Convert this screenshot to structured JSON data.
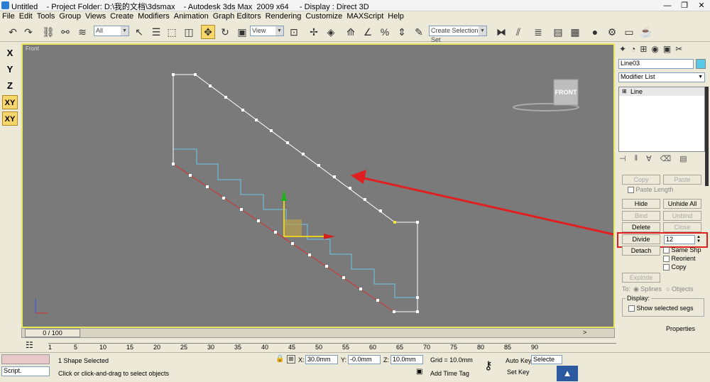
{
  "window": {
    "title": "Untitled    - Project Folder: D:\\我的文档\\3dsmax    - Autodesk 3ds Max  2009 x64     - Display : Direct 3D"
  },
  "menu": [
    "File",
    "Edit",
    "Tools",
    "Group",
    "Views",
    "Create",
    "Modifiers",
    "Animation",
    "Graph Editors",
    "Rendering",
    "Customize",
    "MAXScript",
    "Help"
  ],
  "toolbar": {
    "selection_filter": "All",
    "ref_coord": "View",
    "named_selection_placeholder": "Create Selection Set"
  },
  "axis_constraints": [
    "X",
    "Y",
    "Z",
    "XY",
    "XY"
  ],
  "viewport": {
    "label": "Front",
    "viewcube_label": "FRONT"
  },
  "command_panel": {
    "object_name": "Line03",
    "modifier_list": "Modifier List",
    "stack_item": "Line",
    "buttons": {
      "copy": "Copy",
      "paste": "Paste",
      "paste_length": "Paste Length",
      "hide": "Hide",
      "unhide_all": "Unhide All",
      "bind": "Bind",
      "unbind": "Unbind",
      "delete": "Delete",
      "close": "Close",
      "divide": "Divide",
      "divide_value": "12",
      "detach": "Detach",
      "same_shp": "Same Shp",
      "reorient": "Reorient",
      "copy_cb": "Copy",
      "explode": "Explode",
      "to": "To:",
      "splines": "Splines",
      "objects": "Objects",
      "display": "Display:",
      "show_selected_segs": "Show selected segs",
      "properties": "Properties"
    }
  },
  "timeline": {
    "frame": "0 / 100",
    "ticks": [
      "1",
      "5",
      "10",
      "15",
      "20",
      "25",
      "30",
      "35",
      "40",
      "45",
      "50",
      "55",
      "60",
      "65",
      "70",
      "75",
      "80",
      "85",
      "90"
    ]
  },
  "status": {
    "selection": "1 Shape Selected",
    "prompt": "Click or click-and-drag to select objects",
    "x_label": "X:",
    "x": "30.0mm",
    "y_label": "Y:",
    "y": "-0.0mm",
    "z_label": "Z:",
    "z": "10.0mm",
    "grid": "Grid = 10.0mm",
    "auto_key": "Auto Key",
    "selected": "Selecte",
    "set_key": "Set Key",
    "add_time_tag": "Add Time Tag",
    "script": "Script."
  },
  "colors": {
    "viewport_border": "#e8e85a",
    "spline": "#ffffff",
    "annotation": "#e02020"
  }
}
